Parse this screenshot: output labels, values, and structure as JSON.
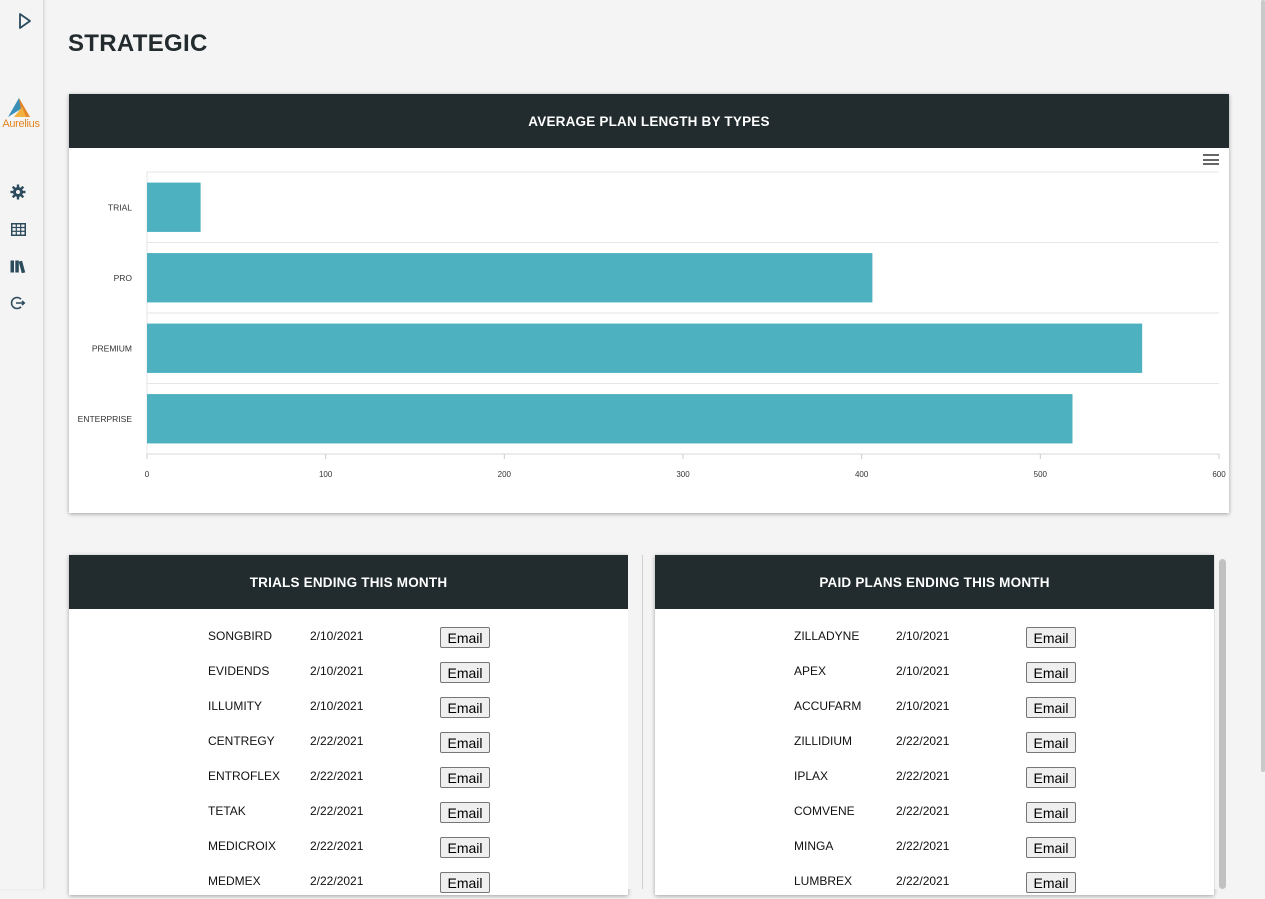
{
  "sidebar": {
    "logo_text": "Aurelius",
    "items": [
      {
        "icon": "play-icon"
      },
      {
        "icon": "gear-icon"
      },
      {
        "icon": "table-icon"
      },
      {
        "icon": "library-icon"
      },
      {
        "icon": "logout-icon"
      }
    ]
  },
  "page": {
    "title": "STRATEGIC"
  },
  "chart_card": {
    "title": "AVERAGE PLAN LENGTH BY TYPES"
  },
  "chart_data": {
    "type": "bar",
    "orientation": "horizontal",
    "title": "AVERAGE PLAN LENGTH BY TYPES",
    "categories": [
      "TRIAL",
      "PRO",
      "PREMIUM",
      "ENTERPRISE"
    ],
    "values": [
      30,
      406,
      557,
      518
    ],
    "xlim": [
      0,
      600
    ],
    "xticks": [
      0,
      100,
      200,
      300,
      400,
      500,
      600
    ],
    "grid": true,
    "color": "#4db1bf"
  },
  "trials": {
    "title": "TRIALS ENDING THIS MONTH",
    "rows": [
      {
        "name": "SONGBIRD",
        "date": "2/10/2021",
        "action": "Email"
      },
      {
        "name": "EVIDENDS",
        "date": "2/10/2021",
        "action": "Email"
      },
      {
        "name": "ILLUMITY",
        "date": "2/10/2021",
        "action": "Email"
      },
      {
        "name": "CENTREGY",
        "date": "2/22/2021",
        "action": "Email"
      },
      {
        "name": "ENTROFLEX",
        "date": "2/22/2021",
        "action": "Email"
      },
      {
        "name": "TETAK",
        "date": "2/22/2021",
        "action": "Email"
      },
      {
        "name": "MEDICROIX",
        "date": "2/22/2021",
        "action": "Email"
      },
      {
        "name": "MEDMEX",
        "date": "2/22/2021",
        "action": "Email"
      }
    ]
  },
  "paid": {
    "title": "PAID PLANS ENDING THIS MONTH",
    "rows": [
      {
        "name": "ZILLADYNE",
        "date": "2/10/2021",
        "action": "Email"
      },
      {
        "name": "APEX",
        "date": "2/10/2021",
        "action": "Email"
      },
      {
        "name": "ACCUFARM",
        "date": "2/10/2021",
        "action": "Email"
      },
      {
        "name": "ZILLIDIUM",
        "date": "2/22/2021",
        "action": "Email"
      },
      {
        "name": "IPLAX",
        "date": "2/22/2021",
        "action": "Email"
      },
      {
        "name": "COMVENE",
        "date": "2/22/2021",
        "action": "Email"
      },
      {
        "name": "MINGA",
        "date": "2/22/2021",
        "action": "Email"
      },
      {
        "name": "LUMBREX",
        "date": "2/22/2021",
        "action": "Email"
      }
    ]
  }
}
